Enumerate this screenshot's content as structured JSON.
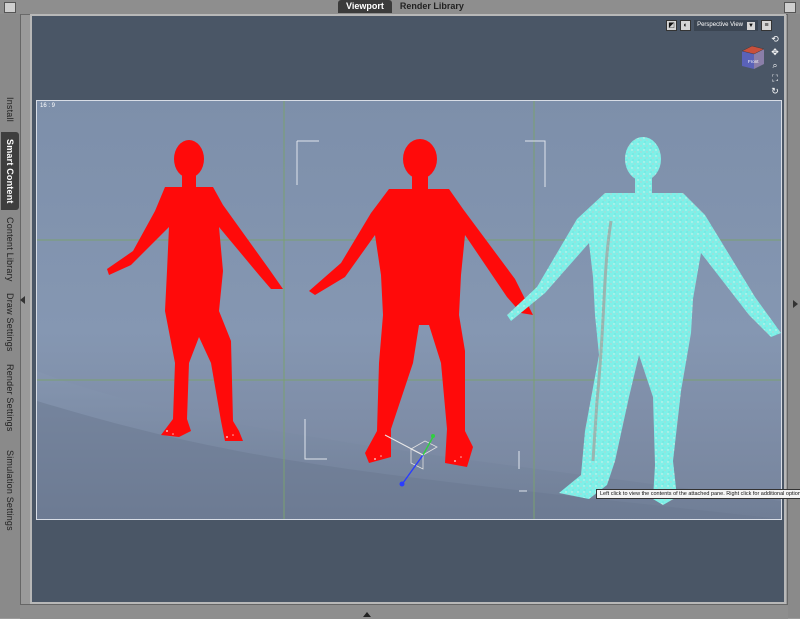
{
  "top_tabs": [
    {
      "label": "Viewport",
      "active": true
    },
    {
      "label": "Render Library",
      "active": false
    }
  ],
  "sidebar": {
    "tabs": [
      {
        "label": "Install",
        "active": false
      },
      {
        "label": "Smart Content",
        "active": true
      },
      {
        "label": "Content Library",
        "active": false
      },
      {
        "label": "Draw Settings",
        "active": false
      },
      {
        "label": "Render Settings",
        "active": false
      },
      {
        "label": "Simulation Settings",
        "active": false
      }
    ]
  },
  "viewport": {
    "view_mode": "Perspective View",
    "view_cube_label": "Front",
    "aspect_ratio": "16 : 9",
    "tooltip": "Left click to view the contents of the attached pane. Right click for additional options"
  },
  "colors": {
    "figure_red": "#ff0a0a",
    "figure_cyan": "#7ff0e8",
    "background_blue": "#8597b2",
    "viewport_border": "#4a5666",
    "guide_line": "#7aa070"
  },
  "icons": {
    "view_toolbar": [
      "camera-icon",
      "shading-icon",
      "lock-icon",
      "menu-icon"
    ],
    "nav_tools": [
      "orbit-icon",
      "pan-icon",
      "zoom-icon",
      "frame-icon",
      "reset-icon"
    ]
  }
}
